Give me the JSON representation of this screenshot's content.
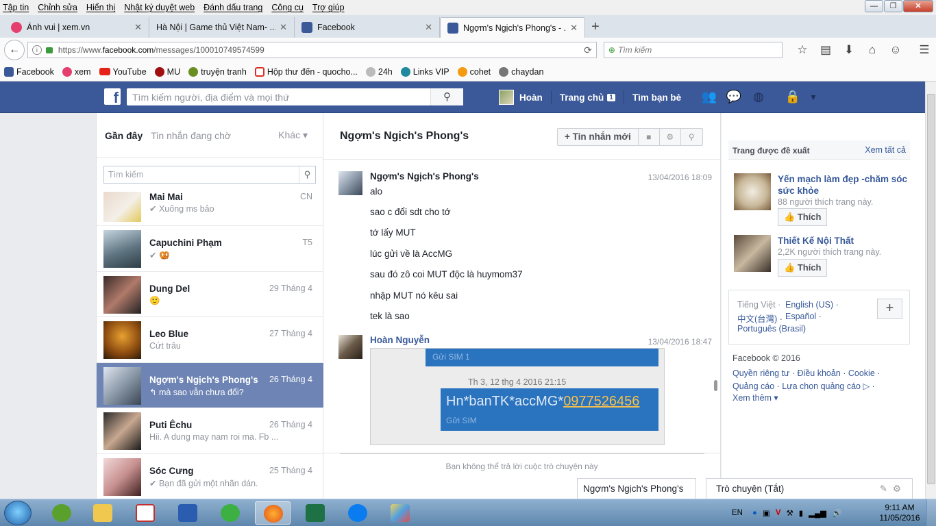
{
  "browser": {
    "menu": [
      "Tập tin",
      "Chỉnh sửa",
      "Hiển thị",
      "Nhật ký duyệt web",
      "Đánh dấu trang",
      "Công cụ",
      "Trợ giúp"
    ],
    "tabs": [
      {
        "label": "Ảnh vui | xem.vn",
        "icon_color": "#e43f6f"
      },
      {
        "label": "Hà Nội | Game thủ Việt Nam- ...",
        "icon_color": "#dde3ea"
      },
      {
        "label": "Facebook",
        "icon_color": "#3b5998"
      },
      {
        "label": "Ngợm's Ngịch's Phong's - ...",
        "icon_color": "#3b5998"
      }
    ],
    "url_prefix": "https://www.",
    "url_domain": "facebook.com",
    "url_path": "/messages/100010749574599",
    "search_placeholder": "Tìm kiếm",
    "bookmarks": [
      {
        "label": "Facebook",
        "color": "#3b5998"
      },
      {
        "label": "xem",
        "color": "#e43f6f"
      },
      {
        "label": "YouTube",
        "color": "#e62117"
      },
      {
        "label": "MU",
        "color": "#a01010"
      },
      {
        "label": "truyện tranh",
        "color": "#6b8e23"
      },
      {
        "label": "Hộp thư đến - quocho...",
        "color": "#d93025"
      },
      {
        "label": "24h",
        "color": "#888888"
      },
      {
        "label": "Links VIP",
        "color": "#1f8a9e"
      },
      {
        "label": "cohet",
        "color": "#f39c12"
      },
      {
        "label": "chaydan",
        "color": "#777777"
      }
    ]
  },
  "fb": {
    "logo": "f",
    "search_placeholder": "Tìm kiếm người, địa điểm và mọi thứ",
    "user": "Hoàn",
    "home": "Trang chủ",
    "home_badge": "1",
    "find_friends": "Tìm bạn bè"
  },
  "left": {
    "tab_recent": "Gần đây",
    "tab_pending": "Tin nhắn đang chờ",
    "tab_more": "Khác ▾",
    "search_placeholder": "Tìm kiếm",
    "conversations": [
      {
        "name": "Mai Mai",
        "date": "CN",
        "snippet": "✔ Xuống ms bảo"
      },
      {
        "name": "Capuchini Phạm",
        "date": "T5",
        "snippet": "✔ 🥨"
      },
      {
        "name": "Dung Del",
        "date": "29 Tháng 4",
        "snippet": "🙂"
      },
      {
        "name": "Leo Blue",
        "date": "27 Tháng 4",
        "snippet": "Cứt trâu"
      },
      {
        "name": "Ngợm's Ngịch's Phong's",
        "date": "26 Tháng 4",
        "snippet": "↰ mà sao vẫn chưa đổi?"
      },
      {
        "name": "Puti Êchu",
        "date": "26 Tháng 4",
        "snippet": "Hii. A dung may nam roi ma. Fb ..."
      },
      {
        "name": "Sóc Cưng",
        "date": "25 Tháng 4",
        "snippet": "✔ Bạn đã gửi một nhãn dán."
      }
    ]
  },
  "thread": {
    "title": "Ngợm's Ngịch's Phong's",
    "new_message": "+ Tin nhắn mới",
    "sender1": "Ngợm's Ngịch's Phong's",
    "time1": "13/04/2016 18:09",
    "lines": [
      "alo",
      "sao c đổi sdt cho tớ",
      "tớ lấy MUT",
      "lúc gửi về là AccMG",
      "sau đó zô coi MUT độc là huymom37",
      "nhập MUT nó kêu sai",
      "tek là sao"
    ],
    "sender2": "Hoàn Nguyễn",
    "time2": "13/04/2016 18:47",
    "attach_sub1": "Gửi SIM 1",
    "attach_date": "Th 3, 12 thg 4 2016 21:15",
    "attach_text": "Hn*banTK*accMG*",
    "attach_phone": "0977526456",
    "attach_sub2": "Gửi SIM",
    "reply_note": "Bạn không thể trả lời cuộc trò chuyện này"
  },
  "right": {
    "suggested_title": "Trang được đề xuất",
    "see_all": "Xem tất cả",
    "pages": [
      {
        "name": "Yến mạch làm đẹp -chăm sóc sức khỏe",
        "likes": "88 người thích trang này.",
        "like_btn": "Thích"
      },
      {
        "name": "Thiết Kế Nội Thất",
        "likes": "2,2K người thích trang này.",
        "like_btn": "Thích"
      }
    ],
    "lang_current": "Tiếng Việt ·",
    "lang_en": "English (US) ·",
    "lang_zh": "中文(台灣) ·",
    "lang_es": "Español ·",
    "lang_pt": "Português (Brasil)",
    "copyright": "Facebook © 2016",
    "footer1": "Quyền riêng tư · Điều khoản · Cookie ·",
    "footer2": "Quảng cáo · Lựa chọn quảng cáo ▷ ·",
    "footer3": "Xem thêm ▾"
  },
  "chat": {
    "tab1": "Ngợm's Ngịch's Phong's",
    "tab2": "Trò chuyện (Tắt)"
  },
  "taskbar": {
    "lang": "EN",
    "time": "9:11 AM",
    "date": "11/05/2016"
  }
}
